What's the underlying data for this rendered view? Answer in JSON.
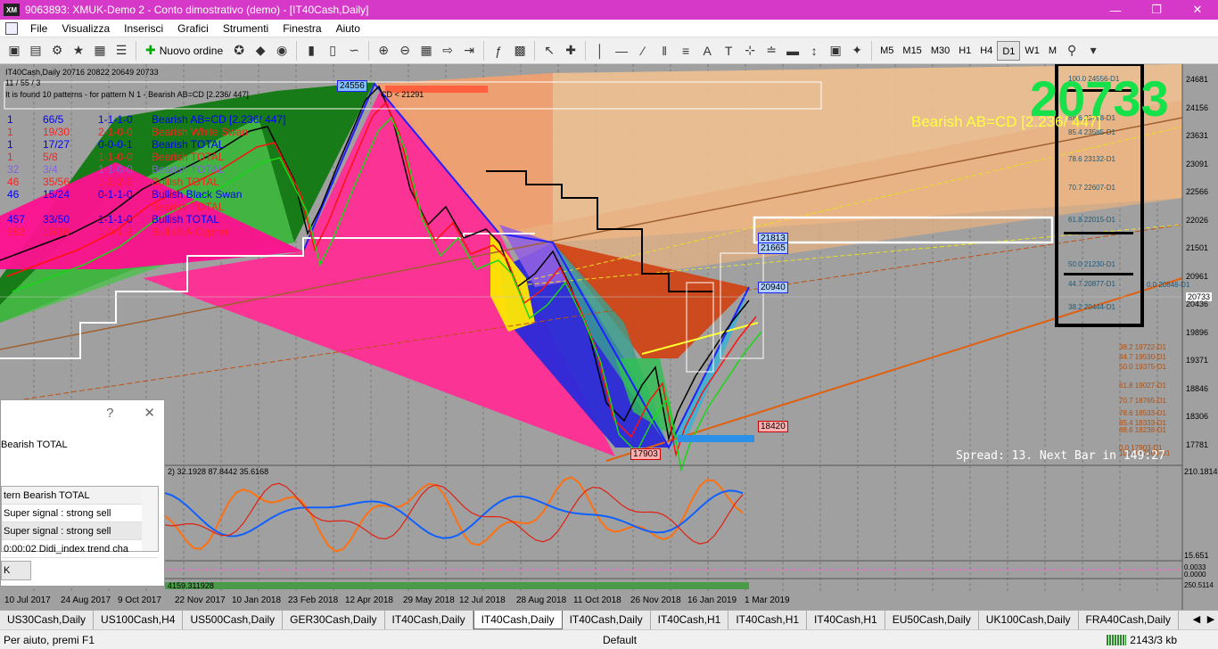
{
  "window": {
    "title": "9063893: XMUK-Demo 2 - Conto dimostrativo (demo) - [IT40Cash,Daily]",
    "logo": "XM",
    "controls": [
      "minimize-icon",
      "restore-icon",
      "close-icon"
    ]
  },
  "menu": [
    "File",
    "Visualizza",
    "Inserisci",
    "Grafici",
    "Strumenti",
    "Finestra",
    "Aiuto"
  ],
  "toolbar": {
    "new_order_label": "Nuovo ordine",
    "timeframes": [
      "M5",
      "M15",
      "M30",
      "H1",
      "H4",
      "D1",
      "W1",
      "M"
    ],
    "active_timeframe": "D1"
  },
  "chart": {
    "symbol_line": "IT40Cash,Daily  20716 20822 20649 20733",
    "counter": "11 / 55 / 3",
    "found_line": "It is found 10 patterns  -  for pattern N 1 - Bearish AB=CD [2.236/ 447]",
    "top_tag_text": "CD < 21291",
    "patterns": [
      {
        "n": "1",
        "score": "66/5",
        "code": "1-1-1-0",
        "name": "Bearish AB=CD [2.236/ 447]"
      },
      {
        "n": "1",
        "score": "19/30",
        "code": "2-1-0-0",
        "name": "Bearish White Swan"
      },
      {
        "n": "1",
        "score": "17/27",
        "code": "0-0-0-1",
        "name": "Bearish TOTAL"
      },
      {
        "n": "1",
        "score": "5/8",
        "code": "1-1-0-0",
        "name": "Bearish TOTAL"
      },
      {
        "n": "32",
        "score": "3/4",
        "code": "1-1-0-0",
        "name": "Bearish TOTAL"
      },
      {
        "n": "46",
        "score": "35/56",
        "code": "1-2-2-2",
        "name": "Bullish TOTAL"
      },
      {
        "n": "46",
        "score": "15/24",
        "code": "0-1-1-0",
        "name": "Bullish Black Swan"
      },
      {
        "n": "",
        "score": "",
        "code": "",
        "name": "Bearish TOTAL"
      },
      {
        "n": "457",
        "score": "33/50",
        "code": "1-1-1-0",
        "name": "Bullish TOTAL"
      },
      {
        "n": "682",
        "score": "10/16",
        "code": "1-0-1-2",
        "name": "Bullish A Cypher"
      }
    ],
    "price_scale": [
      "24681",
      "24156",
      "23631",
      "23091",
      "22566",
      "22026",
      "21501",
      "20961",
      "20733",
      "20436",
      "19896",
      "19371",
      "18846",
      "18306",
      "17781"
    ],
    "current_price": "20733",
    "big_price": "20733",
    "pattern_label": "Bearish AB=CD [2.236/ 447]",
    "tags": {
      "high": "24556",
      "t1": "21813",
      "t2": "21665",
      "t3": "20940",
      "t4": "18420",
      "low": "17903"
    },
    "fib_box_levels": [
      {
        "pct": "100.0",
        "price": "24556-D1"
      },
      {
        "pct": "88.6",
        "price": "23798-D1"
      },
      {
        "pct": "85.4",
        "price": "23585-D1"
      },
      {
        "pct": "78.6",
        "price": "23132-D1"
      },
      {
        "pct": "70.7",
        "price": "22607-D1"
      },
      {
        "pct": "61.8",
        "price": "22015-D1"
      },
      {
        "pct": "50.0",
        "price": "21230-D1"
      },
      {
        "pct": "44.7",
        "price": "20877-D1"
      },
      {
        "pct": "38.2",
        "price": "20444-D1"
      }
    ],
    "fib_right_top": "0.0   20846-D1",
    "fib_lower_levels": [
      {
        "pct": "38.2",
        "price": "19722-D1"
      },
      {
        "pct": "44.7",
        "price": "19530-D1"
      },
      {
        "pct": "50.0",
        "price": "19375-D1"
      },
      {
        "pct": "61.8",
        "price": "19027-D1"
      },
      {
        "pct": "70.7",
        "price": "18765-D1"
      },
      {
        "pct": "78.6",
        "price": "18533-D1"
      },
      {
        "pct": "85.4",
        "price": "18333-D1"
      },
      {
        "pct": "88.6",
        "price": "18238-D1"
      },
      {
        "pct": "0.0",
        "price": "17903-D1"
      },
      {
        "pct": "100.0",
        "price": "17903-D1"
      }
    ],
    "spread_text": "Spread: 13. Next Bar in 149:27",
    "indicator1_label": "2) 32.1928 87.8442 35.6168",
    "indicator1_scale": [
      "210.1814",
      "15.651"
    ],
    "indicator2_scale": [
      "0.0033",
      "0.0000"
    ],
    "indicator3_label": "4159.311928",
    "indicator3_scale": "250.5114",
    "dates": [
      "10 Jul 2017",
      "24 Aug 2017",
      "9 Oct 2017",
      "22 Nov 2017",
      "10 Jan 2018",
      "23 Feb 2018",
      "12 Apr 2018",
      "29 May 2018",
      "12 Jul 2018",
      "28 Aug 2018",
      "11 Oct 2018",
      "26 Nov 2018",
      "16 Jan 2019",
      "1 Mar 2019"
    ]
  },
  "dialog": {
    "help_glyph": "?",
    "close_glyph": "✕",
    "message": "Bearish TOTAL",
    "list_header": "tern Bearish TOTAL",
    "rows": [
      "Super signal : strong sell",
      "Super signal : strong sell",
      "0:00:02 Didi_index trend cha"
    ],
    "ok": "K"
  },
  "tabs": [
    "US30Cash,Daily",
    "US100Cash,H4",
    "US500Cash,Daily",
    "GER30Cash,Daily",
    "IT40Cash,Daily",
    "IT40Cash,Daily",
    "IT40Cash,Daily",
    "IT40Cash,H1",
    "IT40Cash,H1",
    "IT40Cash,H1",
    "EU50Cash,Daily",
    "UK100Cash,Daily",
    "FRA40Cash,Daily"
  ],
  "active_tab_index": 5,
  "status": {
    "help": "Per aiuto, premi F1",
    "profile": "Default",
    "traffic": "2143/3 kb"
  }
}
